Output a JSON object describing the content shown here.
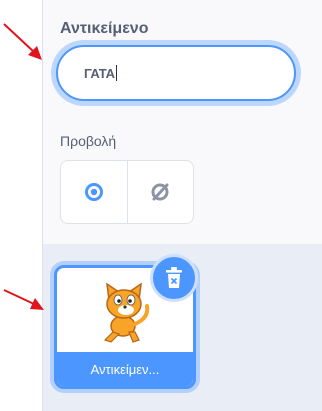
{
  "sprite": {
    "name_label": "Αντικείμενο",
    "name_value": "ΓΑΤΑ"
  },
  "view": {
    "label": "Προβολή",
    "show_icon": "eye-icon",
    "hide_icon": "eye-slash-icon"
  },
  "sprite_tile": {
    "name": "Αντικείμεν...",
    "delete_icon": "trash-icon"
  },
  "colors": {
    "accent": "#4c97ff",
    "arrow": "#e0141e",
    "text": "#575e75"
  }
}
